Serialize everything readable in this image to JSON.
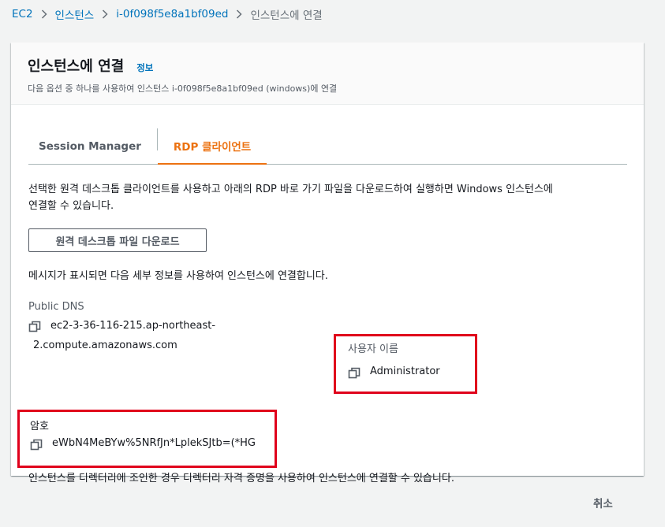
{
  "breadcrumb": {
    "items": [
      "EC2",
      "인스턴스",
      "i-0f098f5e8a1bf09ed"
    ],
    "current": "인스턴스에 연결"
  },
  "panel": {
    "title": "인스턴스에 연결",
    "info_link": "정보",
    "description": "다음 옵션 중 하나를 사용하여 인스턴스 i-0f098f5e8a1bf09ed (windows)에 연결"
  },
  "tabs": [
    {
      "label": "Session Manager",
      "active": false
    },
    {
      "label": "RDP 클라이언트",
      "active": true
    }
  ],
  "rdp": {
    "intro_line1": "선택한 원격 데스크톱 클라이언트를 사용하고 아래의 RDP 바로 가기 파일을 다운로드하여 실행하면 Windows 인스턴스에",
    "intro_line2": "연결할 수 있습니다.",
    "download_button": "원격 데스크톱 파일 다운로드",
    "prompt_message": "메시지가 표시되면 다음 세부 정보를 사용하여 인스턴스에 연결합니다.",
    "public_dns_label": "Public DNS",
    "public_dns_line1": "ec2-3-36-116-215.ap-northeast-",
    "public_dns_line2": "2.compute.amazonaws.com",
    "username_label": "사용자 이름",
    "username_value": "Administrator",
    "password_label": "암호",
    "password_value": "eWbN4MeBYw%5NRfJn*LplekSJtb=(*HG",
    "directory_note": "인스턴스를 디렉터리에 조인한 경우 디렉터리 자격 증명을 사용하여 인스턴스에 연결할 수 있습니다."
  },
  "footer": {
    "cancel_label": "취소"
  },
  "icons": {
    "separator": "chevron-right-icon",
    "copy": "copy-icon"
  },
  "colors": {
    "link": "#0073bb",
    "active_tab": "#ec7211",
    "highlight_frame": "#e0001b"
  }
}
